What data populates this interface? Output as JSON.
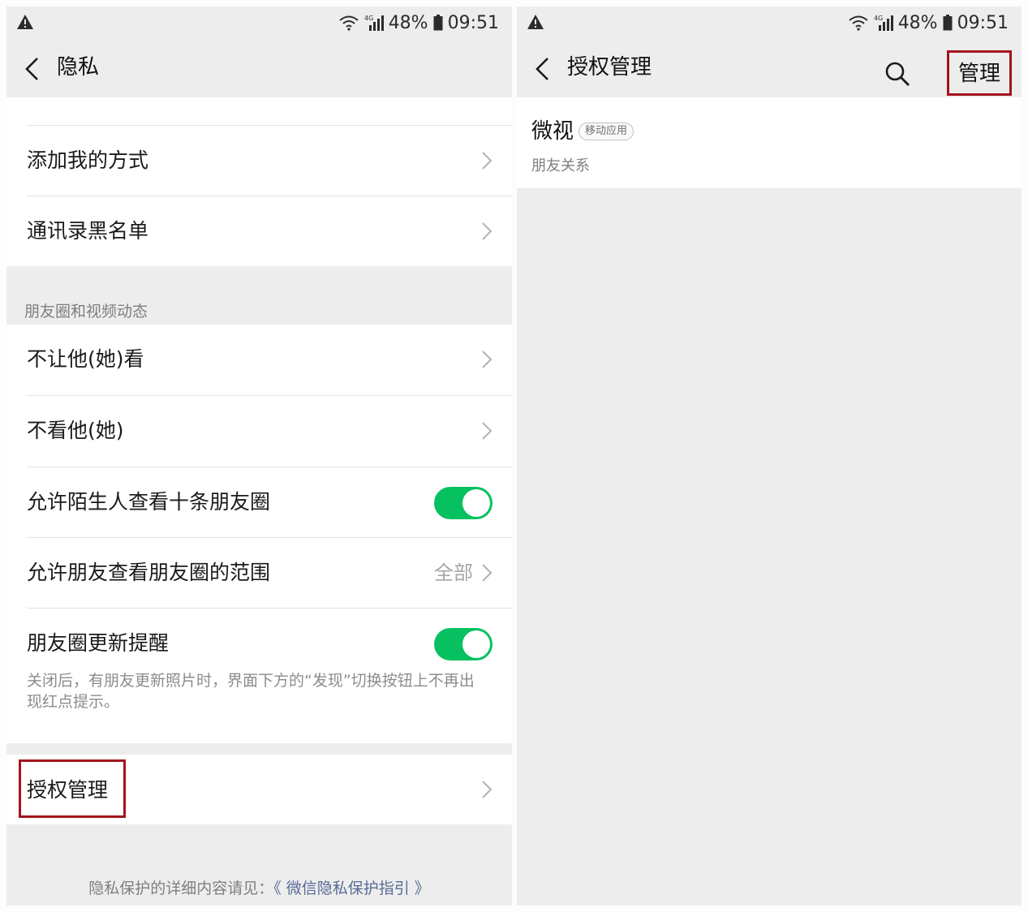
{
  "status_bar": {
    "battery": "48%",
    "time": "09:51",
    "network": "4G"
  },
  "left": {
    "title": "隐私",
    "items": [
      {
        "label": "添加我的方式"
      },
      {
        "label": "通讯录黑名单"
      }
    ],
    "moments_group_title": "朋友圈和视频动态",
    "moments_items": [
      {
        "label": "不让他(她)看"
      },
      {
        "label": "不看他(她)"
      },
      {
        "label": "允许陌生人查看十条朋友圈",
        "toggle_on": true
      },
      {
        "label": "允许朋友查看朋友圈的范围",
        "value": "全部"
      },
      {
        "label": "朋友圈更新提醒",
        "toggle_on": true,
        "description": "关闭后，有朋友更新照片时，界面下方的“发现”切换按钮上不再出现红点提示。"
      }
    ],
    "auth_item": {
      "label": "授权管理"
    },
    "footer": {
      "text": "隐私保护的详细内容请见：",
      "link": "《 微信隐私保护指引 》"
    }
  },
  "right": {
    "title": "授权管理",
    "manage_label": "管理",
    "apps": [
      {
        "name": "微视",
        "tag": "移动应用",
        "desc": "朋友关系"
      }
    ]
  },
  "colors": {
    "toggle_on": "#07c160",
    "highlight_border": "#a3141c",
    "link": "#576b95",
    "background": "#ededed"
  },
  "icons": [
    "warning-icon",
    "wifi-icon",
    "signal-icon",
    "battery-icon",
    "back-icon",
    "chevron-right-icon",
    "search-icon"
  ]
}
